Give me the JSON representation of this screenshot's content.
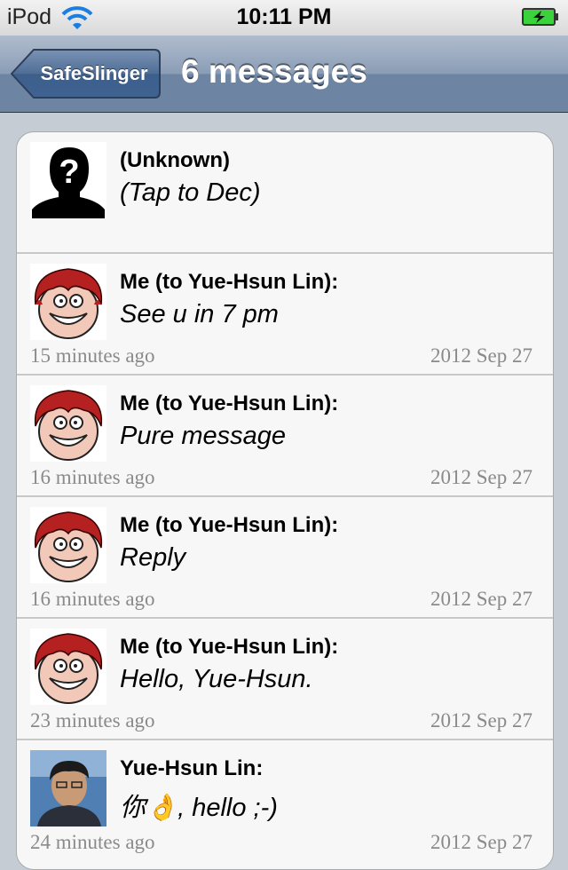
{
  "status_bar": {
    "carrier": "iPod",
    "time": "10:11 PM"
  },
  "nav": {
    "back_label": "SafeSlinger",
    "title": "6 messages"
  },
  "messages": [
    {
      "sender": "(Unknown)",
      "body": "(Tap to Dec)",
      "ago": "",
      "date": "",
      "avatar": "unknown-silhouette"
    },
    {
      "sender": "Me (to Yue-Hsun Lin):",
      "body": "See u in 7 pm",
      "ago": "15 minutes ago",
      "date": "2012 Sep 27",
      "avatar": "cartoon-face"
    },
    {
      "sender": "Me (to Yue-Hsun Lin):",
      "body": "Pure message",
      "ago": "16 minutes ago",
      "date": "2012 Sep 27",
      "avatar": "cartoon-face"
    },
    {
      "sender": "Me (to Yue-Hsun Lin):",
      "body": "Reply",
      "ago": "16 minutes ago",
      "date": "2012 Sep 27",
      "avatar": "cartoon-face"
    },
    {
      "sender": "Me (to Yue-Hsun Lin):",
      "body": "Hello, Yue-Hsun.",
      "ago": "23 minutes ago",
      "date": "2012 Sep 27",
      "avatar": "cartoon-face"
    },
    {
      "sender": "Yue-Hsun Lin:",
      "body": "你👌,  hello ;-)",
      "ago": "24 minutes ago",
      "date": "2012 Sep 27",
      "avatar": "contact-photo"
    }
  ],
  "colors": {
    "nav_bar": "#6d84a2",
    "list_bg": "#f7f7f7",
    "meta_text": "#8a8a8a",
    "battery": "#3bd33b"
  }
}
